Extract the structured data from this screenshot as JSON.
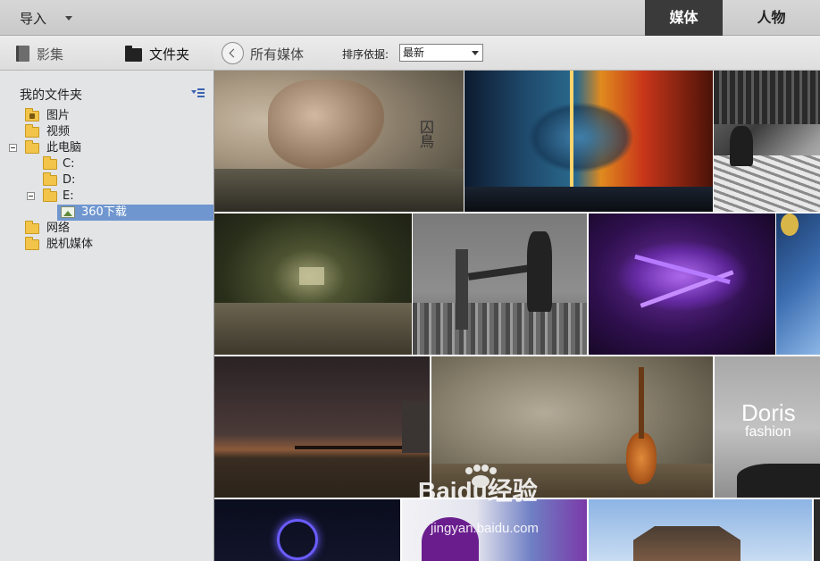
{
  "topbar": {
    "import_label": "导入",
    "tabs": {
      "media": "媒体",
      "people": "人物"
    }
  },
  "sidebar": {
    "tabs": {
      "albums": "影集",
      "folders": "文件夹"
    },
    "section_title": "我的文件夹",
    "tree": [
      {
        "label": "图片",
        "icon": "pictures-folder-icon"
      },
      {
        "label": "视频",
        "icon": "folder-icon"
      },
      {
        "label": "此电脑",
        "icon": "folder-icon",
        "expanded": true
      },
      {
        "label": "C:",
        "icon": "folder-icon"
      },
      {
        "label": "D:",
        "icon": "folder-icon"
      },
      {
        "label": "E:",
        "icon": "folder-icon",
        "expanded": true
      },
      {
        "label": "360下载",
        "icon": "image-folder-icon",
        "selected": true
      },
      {
        "label": "网络",
        "icon": "folder-icon"
      },
      {
        "label": "脱机媒体",
        "icon": "folder-icon"
      }
    ]
  },
  "content": {
    "breadcrumb": "所有媒体",
    "sort_label": "排序依据:",
    "sort_value": "最新"
  },
  "thumbnails": [
    {
      "name": "woman-sleeping",
      "overlay": "囚鳥"
    },
    {
      "name": "fire-ice-tree"
    },
    {
      "name": "bookstore-man"
    },
    {
      "name": "forest-path"
    },
    {
      "name": "kick-city"
    },
    {
      "name": "purple-plant"
    },
    {
      "name": "blue-water"
    },
    {
      "name": "dusk-horses"
    },
    {
      "name": "guitar-wall"
    },
    {
      "name": "doris-fashion",
      "overlay": "Doris",
      "overlay2": "fashion"
    },
    {
      "name": "ferris-wheel"
    },
    {
      "name": "purple-woman"
    },
    {
      "name": "pagoda"
    },
    {
      "name": "dark-edge"
    }
  ],
  "watermark": {
    "brand": "Baidu经验",
    "url": "jingyan.baidu.com"
  },
  "colors": {
    "selection": "#6f96cf",
    "active_tab": "#3a3a3a",
    "folder": "#f2c44a"
  }
}
